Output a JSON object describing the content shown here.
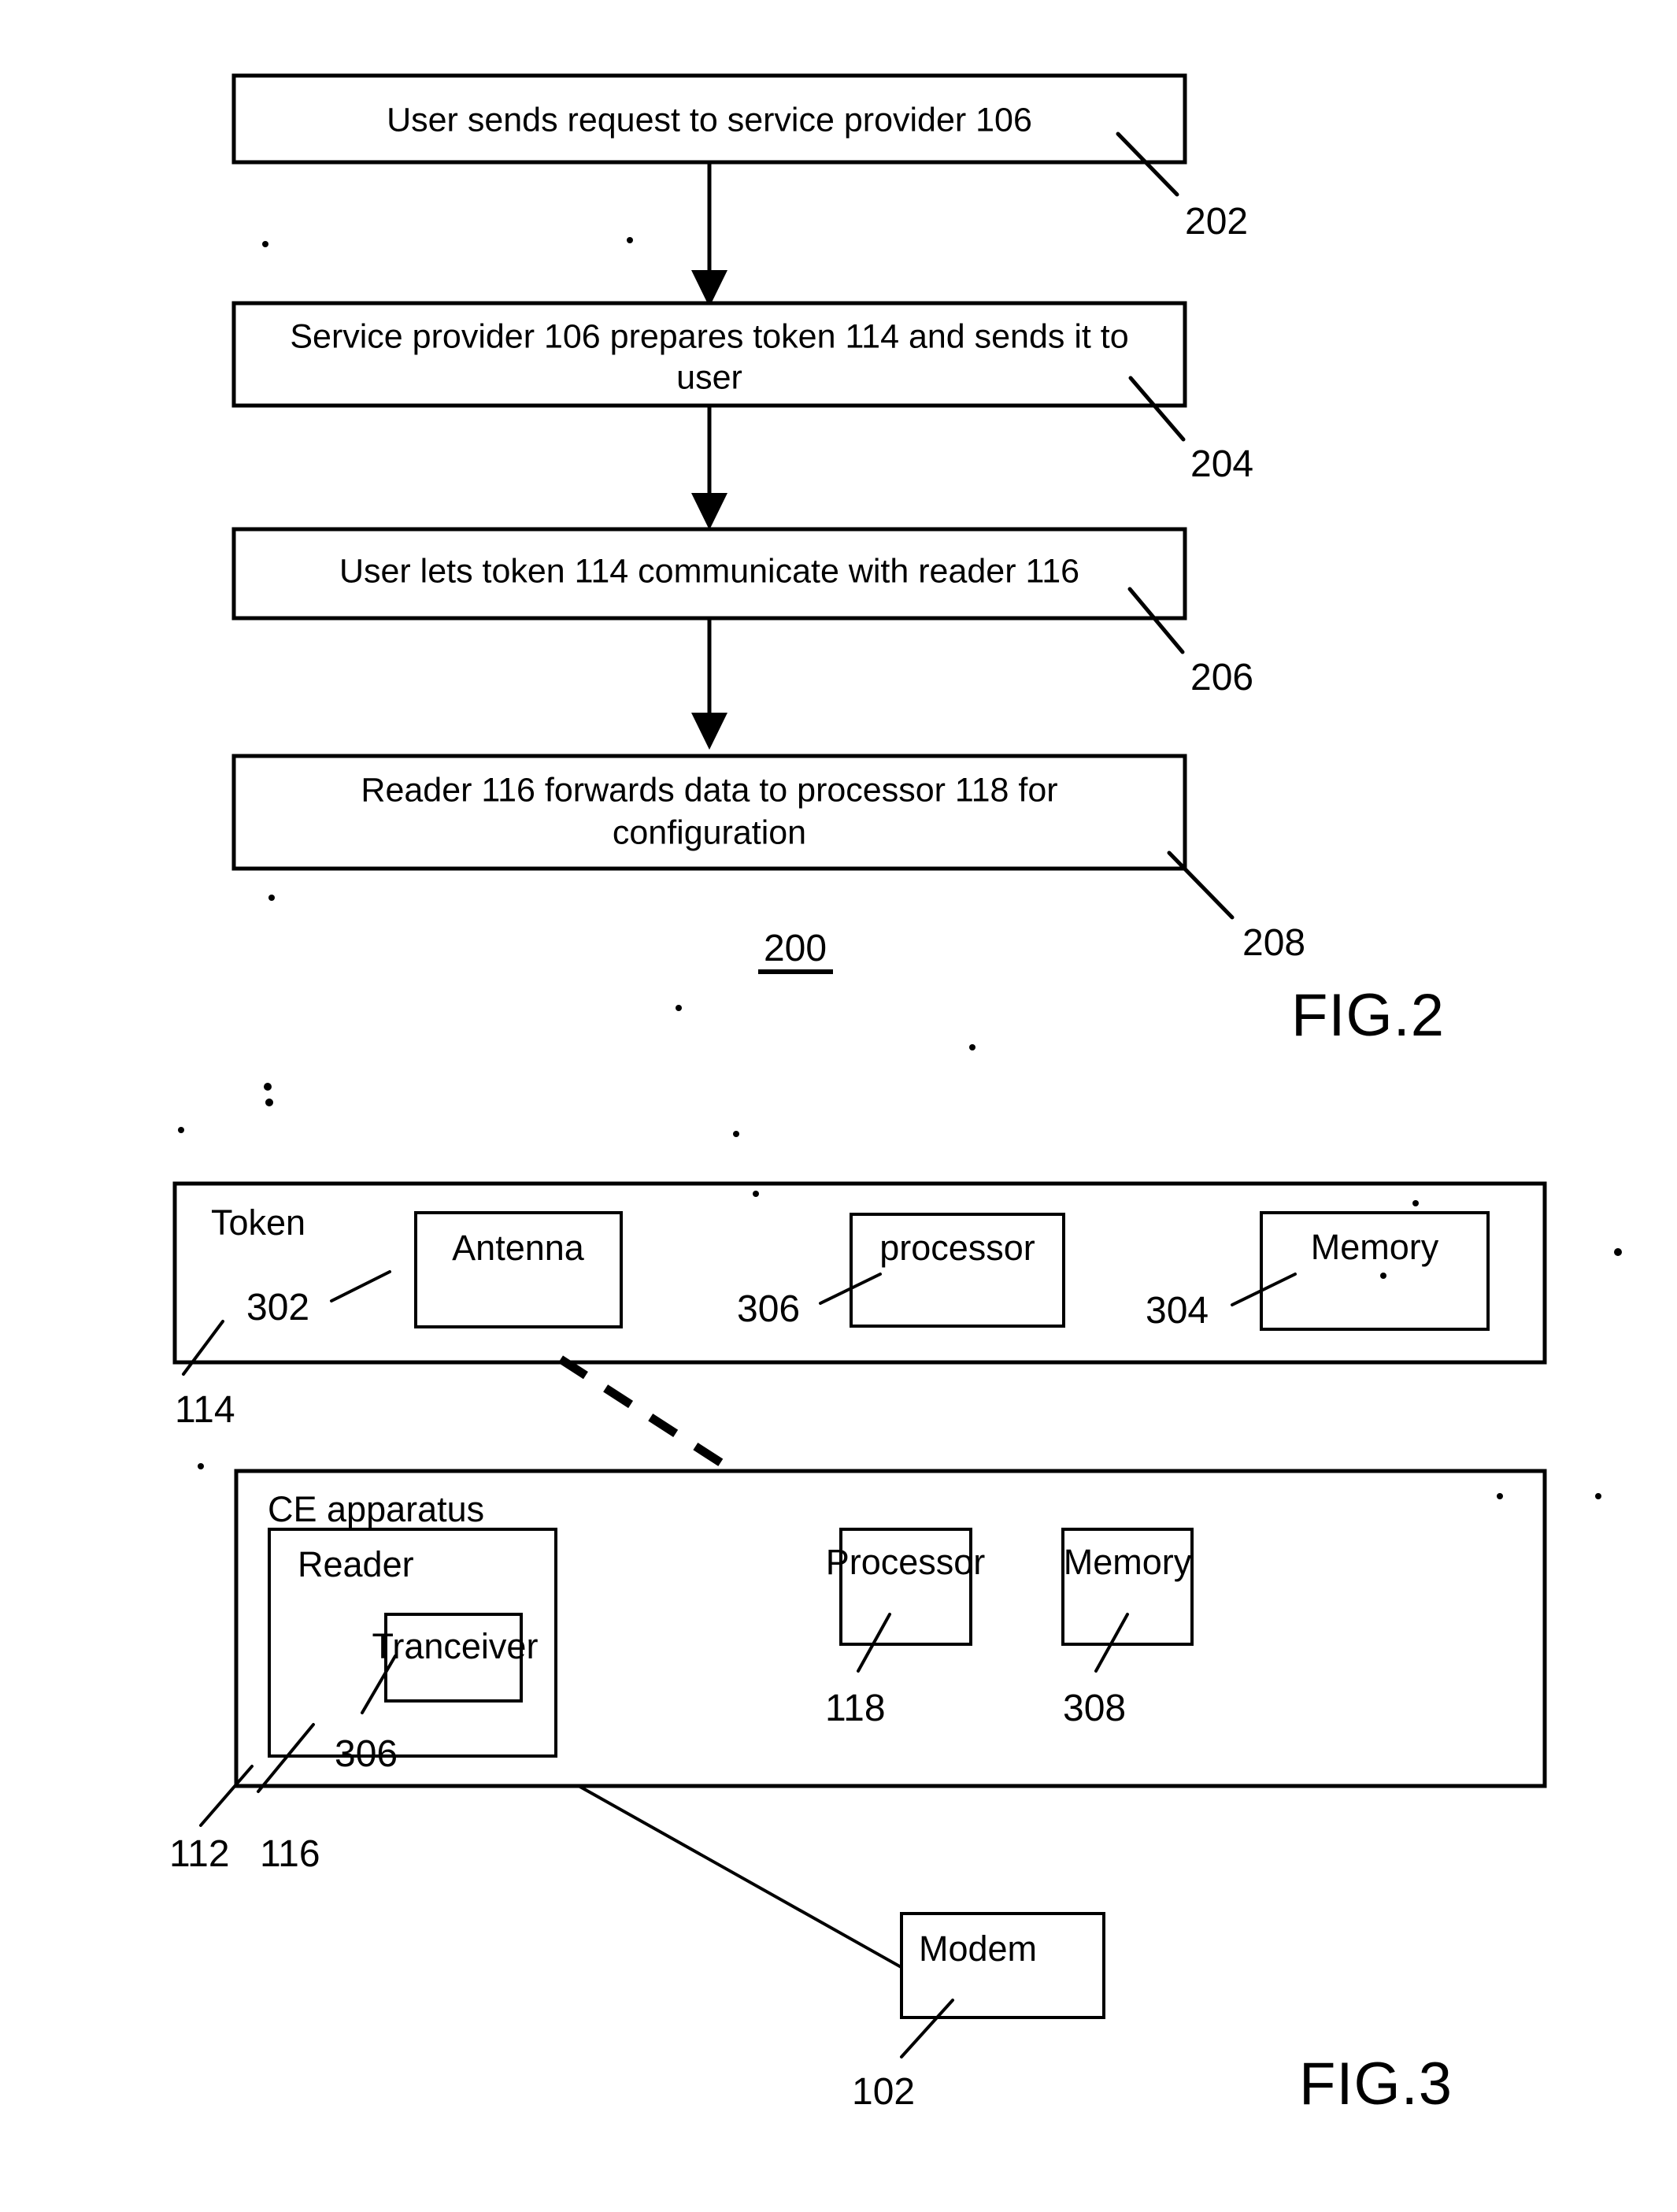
{
  "document": {
    "kind": "patent-drawing-sheet",
    "figures": [
      "FIG.2",
      "FIG.3"
    ]
  },
  "fig2": {
    "label": "FIG.2",
    "diagram_ref": "200",
    "steps": [
      {
        "ref": "202",
        "lines": [
          "User sends request to service provider 106"
        ]
      },
      {
        "ref": "204",
        "lines": [
          "Service provider 106 prepares token 114 and sends it to",
          "user"
        ]
      },
      {
        "ref": "206",
        "lines": [
          "User lets token 114 communicate with reader 116"
        ]
      },
      {
        "ref": "208",
        "lines": [
          "Reader 116 forwards data to processor 118 for",
          "configuration"
        ]
      }
    ]
  },
  "fig3": {
    "label": "FIG.3",
    "token": {
      "title": "Token",
      "ref": "114",
      "components": [
        {
          "title": "Antenna",
          "ref": "302"
        },
        {
          "title": "processor",
          "ref": "306"
        },
        {
          "title": "Memory",
          "ref": "304"
        }
      ]
    },
    "ce_apparatus": {
      "title": "CE apparatus",
      "ref": "112",
      "reader": {
        "title": "Reader",
        "ref": "116",
        "components": [
          {
            "title": "Tranceiver",
            "ref": "306"
          }
        ]
      },
      "components": [
        {
          "title": "Processor",
          "ref": "118"
        },
        {
          "title": "Memory",
          "ref": "308"
        }
      ]
    },
    "modem": {
      "title": "Modem",
      "ref": "102"
    }
  },
  "colors": {
    "ink": "#000000",
    "paper": "#ffffff"
  }
}
